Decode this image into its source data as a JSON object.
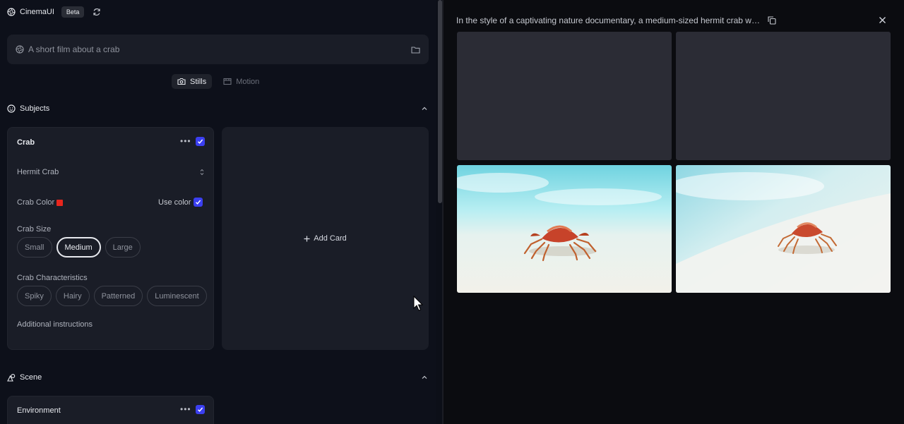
{
  "app": {
    "name": "CinemaUI",
    "badge": "Beta"
  },
  "prompt": {
    "placeholder": "A short film about a crab"
  },
  "mode_tabs": [
    {
      "label": "Stills",
      "active": true
    },
    {
      "label": "Motion",
      "active": false
    }
  ],
  "sections": {
    "subjects": {
      "title": "Subjects"
    },
    "scene": {
      "title": "Scene"
    }
  },
  "subject_card": {
    "title": "Crab",
    "select_value": "Hermit Crab",
    "color_label": "Crab Color",
    "color_value": "#e8261d",
    "use_color_label": "Use color",
    "size_label": "Crab Size",
    "sizes": [
      {
        "label": "Small",
        "active": false
      },
      {
        "label": "Medium",
        "active": true
      },
      {
        "label": "Large",
        "active": false
      }
    ],
    "characteristics_label": "Crab Characteristics",
    "characteristics": [
      {
        "label": "Spiky"
      },
      {
        "label": "Hairy"
      },
      {
        "label": "Patterned"
      },
      {
        "label": "Luminescent"
      }
    ],
    "additional_label": "Additional instructions"
  },
  "add_card": {
    "label": "Add Card"
  },
  "scene_card": {
    "title": "Environment"
  },
  "results": {
    "prompt_text": "In the style of a captivating nature documentary, a medium-sized hermit crab wit…"
  },
  "colors": {
    "accent": "#3b3ff0",
    "panel": "#1a1d27",
    "background": "#0d101a"
  }
}
